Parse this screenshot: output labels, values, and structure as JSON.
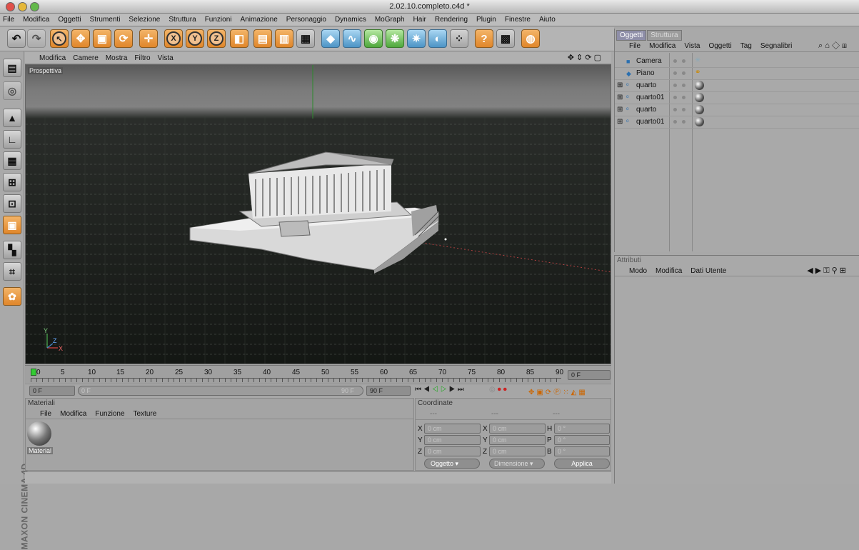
{
  "window": {
    "title": "2.02.10.completo.c4d *"
  },
  "menubar": [
    "File",
    "Modifica",
    "Oggetti",
    "Strumenti",
    "Selezione",
    "Struttura",
    "Funzioni",
    "Animazione",
    "Personaggio",
    "Dynamics",
    "MoGraph",
    "Hair",
    "Rendering",
    "Plugin",
    "Finestre",
    "Aiuto"
  ],
  "toolbar": {
    "icons": [
      "undo-icon",
      "redo-icon",
      "select-icon",
      "move-icon",
      "scale-icon",
      "rotate-icon",
      "move-axis-icon",
      "x-axis-icon",
      "y-axis-icon",
      "z-axis-icon",
      "coordinate-system-icon",
      "render-view-icon",
      "render-picture-viewer-icon",
      "render-settings-icon",
      "cube-primitive-icon",
      "spline-icon",
      "nurbs-icon",
      "array-icon",
      "deformer-icon",
      "scene-icon",
      "particles-icon",
      "help-icon",
      "live-select-icon",
      "web-icon"
    ],
    "axis_labels": [
      "X",
      "Y",
      "Z"
    ]
  },
  "viewport": {
    "menu": [
      "Modifica",
      "Camere",
      "Mostra",
      "Filtro",
      "Vista"
    ],
    "label": "Prospettiva"
  },
  "timeline": {
    "ticks": [
      "0",
      "5",
      "10",
      "15",
      "20",
      "25",
      "30",
      "35",
      "40",
      "45",
      "50",
      "55",
      "60",
      "65",
      "70",
      "75",
      "80",
      "85",
      "90"
    ],
    "current_frame": "0 F",
    "start": "0 F",
    "range_start": "0 F",
    "range_end": "90 F",
    "end": "90 F"
  },
  "materials": {
    "title": "Materiali",
    "menu": [
      "File",
      "Modifica",
      "Funzione",
      "Texture"
    ],
    "items": [
      {
        "name": "Material"
      }
    ]
  },
  "coordinates": {
    "title": "Coordinate",
    "headers": [
      "---",
      "---",
      "---"
    ],
    "position": {
      "x": "0 cm",
      "y": "0 cm",
      "z": "0 cm"
    },
    "size": {
      "x": "0 cm",
      "y": "0 cm",
      "z": "0 cm"
    },
    "rotation": {
      "h": "0 °",
      "p": "0 °",
      "b": "0 °"
    },
    "axis_letters": {
      "x": "X",
      "y": "Y",
      "z": "Z",
      "h": "H",
      "p": "P",
      "b": "B"
    },
    "mode_select": "Oggetto",
    "size_select": "Dimensione",
    "apply_label": "Applica"
  },
  "objects": {
    "tabs": [
      "Oggetti",
      "Struttura"
    ],
    "menu": [
      "File",
      "Modifica",
      "Vista",
      "Oggetti",
      "Tag",
      "Segnalibri"
    ],
    "items": [
      {
        "name": "Camera",
        "icon": "camera-icon"
      },
      {
        "name": "Piano",
        "icon": "plane-icon"
      },
      {
        "name": "quarto",
        "icon": "null-object-icon"
      },
      {
        "name": "quarto01",
        "icon": "null-object-icon"
      },
      {
        "name": "quarto",
        "icon": "null-object-icon"
      },
      {
        "name": "quarto01",
        "icon": "null-object-icon"
      }
    ]
  },
  "attributes": {
    "title": "Attributi",
    "menu": [
      "Modo",
      "Modifica",
      "Dati Utente"
    ]
  },
  "branding": {
    "text": "MAXON CINEMA 4D"
  }
}
